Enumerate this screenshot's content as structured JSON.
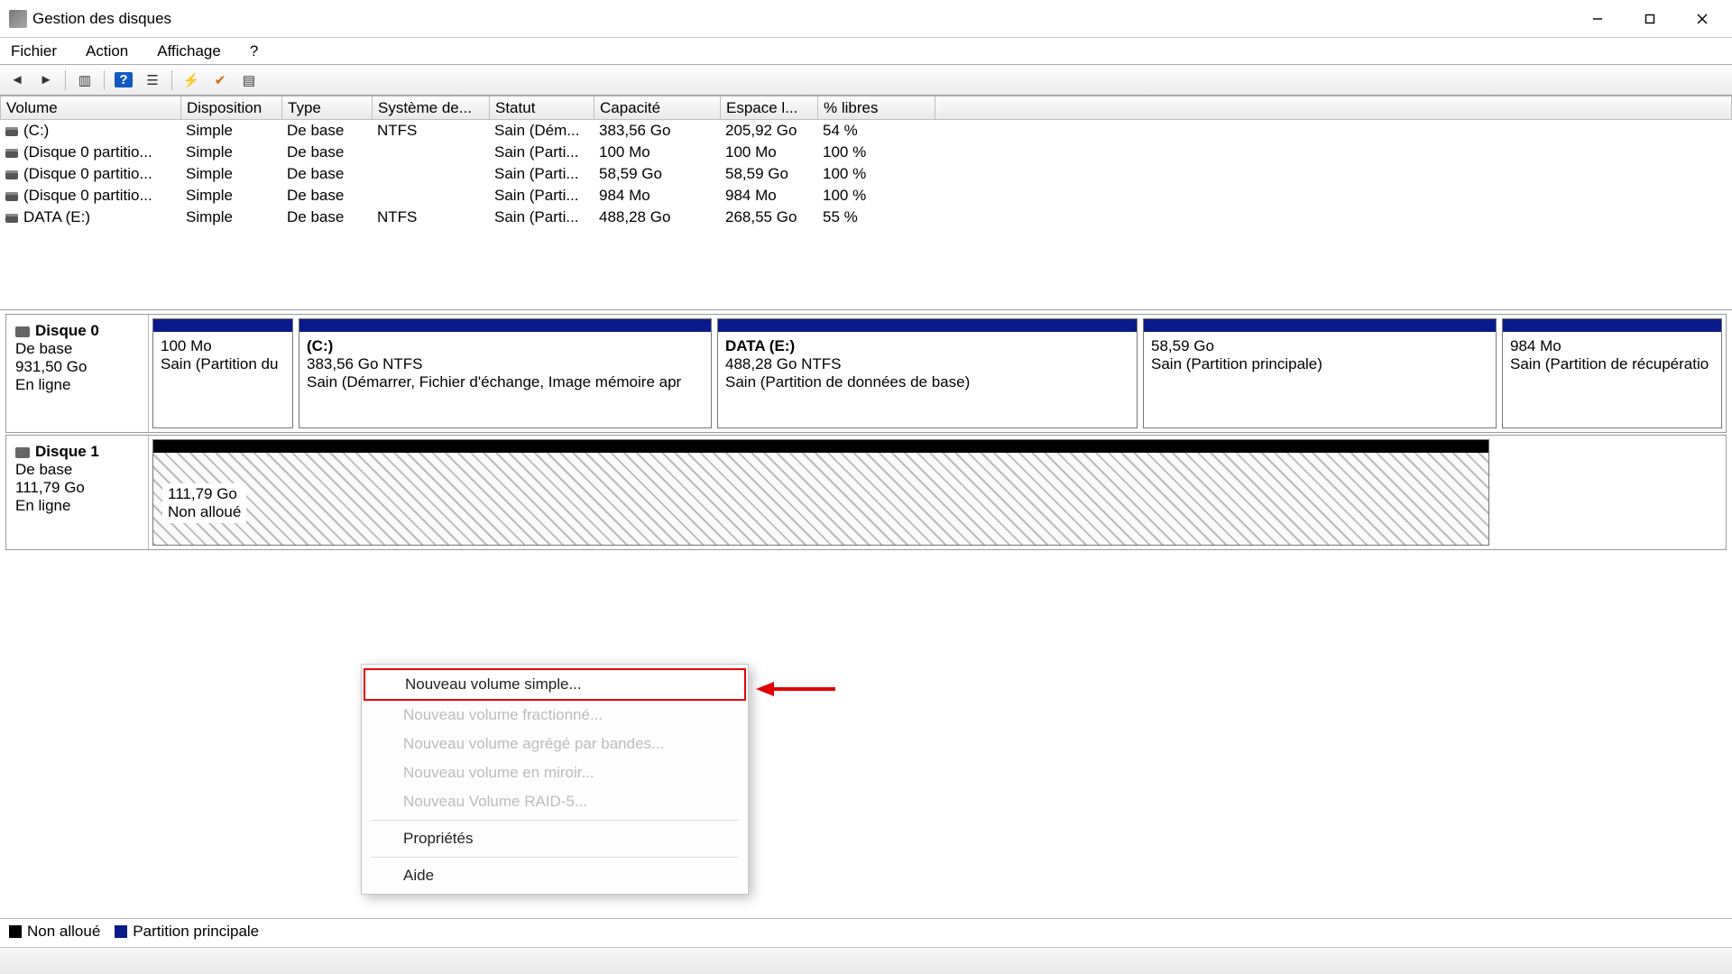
{
  "window": {
    "title": "Gestion des disques"
  },
  "menu": {
    "file": "Fichier",
    "action": "Action",
    "view": "Affichage",
    "help": "?"
  },
  "table": {
    "headers": {
      "volume": "Volume",
      "disposition": "Disposition",
      "type": "Type",
      "fs": "Système de...",
      "status": "Statut",
      "capacity": "Capacité",
      "free": "Espace l...",
      "pctfree": "% libres"
    },
    "rows": [
      {
        "volume": "(C:)",
        "disposition": "Simple",
        "type": "De base",
        "fs": "NTFS",
        "status": "Sain (Dém...",
        "capacity": "383,56 Go",
        "free": "205,92 Go",
        "pctfree": "54 %"
      },
      {
        "volume": "(Disque 0 partitio...",
        "disposition": "Simple",
        "type": "De base",
        "fs": "",
        "status": "Sain (Parti...",
        "capacity": "100 Mo",
        "free": "100 Mo",
        "pctfree": "100 %"
      },
      {
        "volume": "(Disque 0 partitio...",
        "disposition": "Simple",
        "type": "De base",
        "fs": "",
        "status": "Sain (Parti...",
        "capacity": "58,59 Go",
        "free": "58,59 Go",
        "pctfree": "100 %"
      },
      {
        "volume": "(Disque 0 partitio...",
        "disposition": "Simple",
        "type": "De base",
        "fs": "",
        "status": "Sain (Parti...",
        "capacity": "984 Mo",
        "free": "984 Mo",
        "pctfree": "100 %"
      },
      {
        "volume": "DATA (E:)",
        "disposition": "Simple",
        "type": "De base",
        "fs": "NTFS",
        "status": "Sain (Parti...",
        "capacity": "488,28 Go",
        "free": "268,55 Go",
        "pctfree": "55 %"
      }
    ]
  },
  "disk0": {
    "name": "Disque 0",
    "basic": "De base",
    "size": "931,50 Go",
    "state": "En ligne",
    "parts": [
      {
        "name": "",
        "line1": "100 Mo",
        "line2": "Sain (Partition du"
      },
      {
        "name": "(C:)",
        "line1": "383,56 Go NTFS",
        "line2": "Sain (Démarrer, Fichier d'échange, Image mémoire apr"
      },
      {
        "name": "DATA  (E:)",
        "line1": "488,28 Go NTFS",
        "line2": "Sain (Partition de données de base)"
      },
      {
        "name": "",
        "line1": "58,59 Go",
        "line2": "Sain (Partition principale)"
      },
      {
        "name": "",
        "line1": "984 Mo",
        "line2": "Sain (Partition de récupératio"
      }
    ]
  },
  "disk1": {
    "name": "Disque 1",
    "basic": "De base",
    "size": "111,79 Go",
    "state": "En ligne",
    "unalloc_size": "111,79 Go",
    "unalloc_label": "Non alloué"
  },
  "ctx": {
    "new_simple": "Nouveau volume simple...",
    "new_spanned": "Nouveau volume fractionné...",
    "new_striped": "Nouveau volume agrégé par bandes...",
    "new_mirror": "Nouveau volume en miroir...",
    "new_raid5": "Nouveau Volume RAID-5...",
    "properties": "Propriétés",
    "help": "Aide"
  },
  "legend": {
    "unalloc": "Non alloué",
    "primary": "Partition principale"
  }
}
